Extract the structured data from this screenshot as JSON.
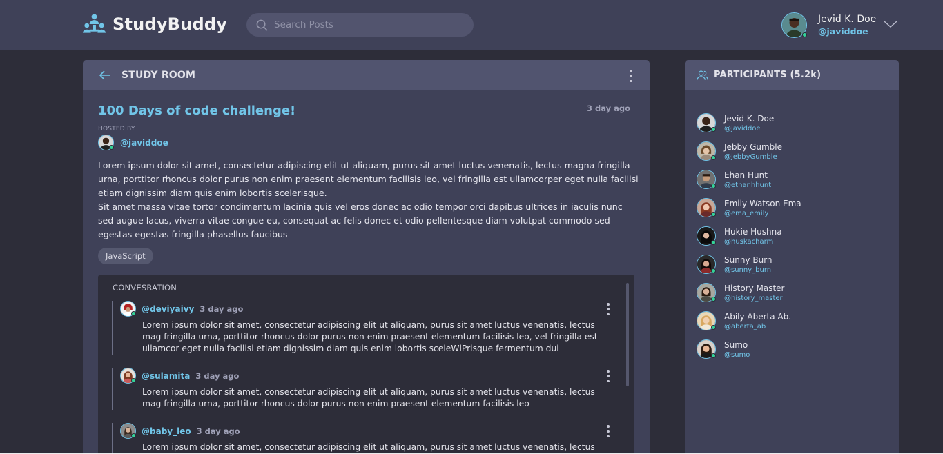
{
  "app": {
    "name": "StudyBuddy"
  },
  "search": {
    "placeholder": "Search Posts"
  },
  "user": {
    "name": "Jevid K. Doe",
    "handle": "@javiddoe"
  },
  "room": {
    "header": "STUDY ROOM",
    "title": "100 Days of code challenge!",
    "time": "3 day ago",
    "hosted_label": "HOSTED BY",
    "host_handle": "@javiddoe",
    "description_1": "Lorem ipsum dolor sit amet, consectetur adipiscing elit ut aliquam, purus sit amet luctus venenatis, lectus magna fringilla urna, porttitor rhoncus dolor purus non enim praesent elementum facilisis leo, vel fringilla est ullamcorper eget nulla facilisi etiam dignissim diam quis enim lobortis scelerisque.",
    "description_2": "Sit amet massa vitae tortor condimentum lacinia quis vel eros donec ac odio tempor orci dapibus ultrices in iaculis nunc sed augue lacus, viverra vitae congue eu, consequat ac felis donec et odio pellentesque diam volutpat commodo sed egestas egestas fringilla phasellus faucibus",
    "tag": "JavaScript"
  },
  "conversation": {
    "label": "CONVESRATION",
    "messages": [
      {
        "user": "@deviyaivy",
        "time": "3 day ago",
        "body": "Lorem ipsum dolor sit amet, consectetur adipiscing elit ut aliquam, purus sit amet luctus venenatis, lectus mag fringilla urna, porttitor rhoncus dolor purus non enim praesent elementum facilisis leo, vel fringilla est ullamcor eget nulla facilisi etiam dignissim diam quis enim lobortis sceleWlPrisque fermentum dui"
      },
      {
        "user": "@sulamita",
        "time": "3 day ago",
        "body": "Lorem ipsum dolor sit amet, consectetur adipiscing elit ut aliquam, purus sit amet luctus venenatis, lectus mag fringilla urna, porttitor rhoncus dolor purus non enim praesent elementum facilisis leo"
      },
      {
        "user": "@baby_leo",
        "time": "3 day ago",
        "body": "Lorem ipsum dolor sit amet, consectetur adipiscing elit ut aliquam, purus sit amet luctus venenatis, lectus mag"
      }
    ]
  },
  "participants": {
    "title": "PARTICIPANTS (5.2k)",
    "items": [
      {
        "name": "Jevid K. Doe",
        "handle": "@javiddoe"
      },
      {
        "name": "Jebby Gumble",
        "handle": "@jebbyGumble"
      },
      {
        "name": "Ehan Hunt",
        "handle": "@ethanhhunt"
      },
      {
        "name": "Emily Watson Ema",
        "handle": "@ema_emily"
      },
      {
        "name": "Hukie Hushna",
        "handle": "@huskacharm"
      },
      {
        "name": "Sunny Burn",
        "handle": "@sunny_burn"
      },
      {
        "name": "History Master",
        "handle": "@history_master"
      },
      {
        "name": "Abily Aberta Ab.",
        "handle": "@aberta_ab"
      },
      {
        "name": "Sumo",
        "handle": "@sumo"
      }
    ]
  },
  "colors": {
    "accent": "#71c5e8",
    "panel": "#3f4158",
    "panel_header": "#51546f",
    "background": "#2d2d39",
    "online": "#34d399"
  }
}
